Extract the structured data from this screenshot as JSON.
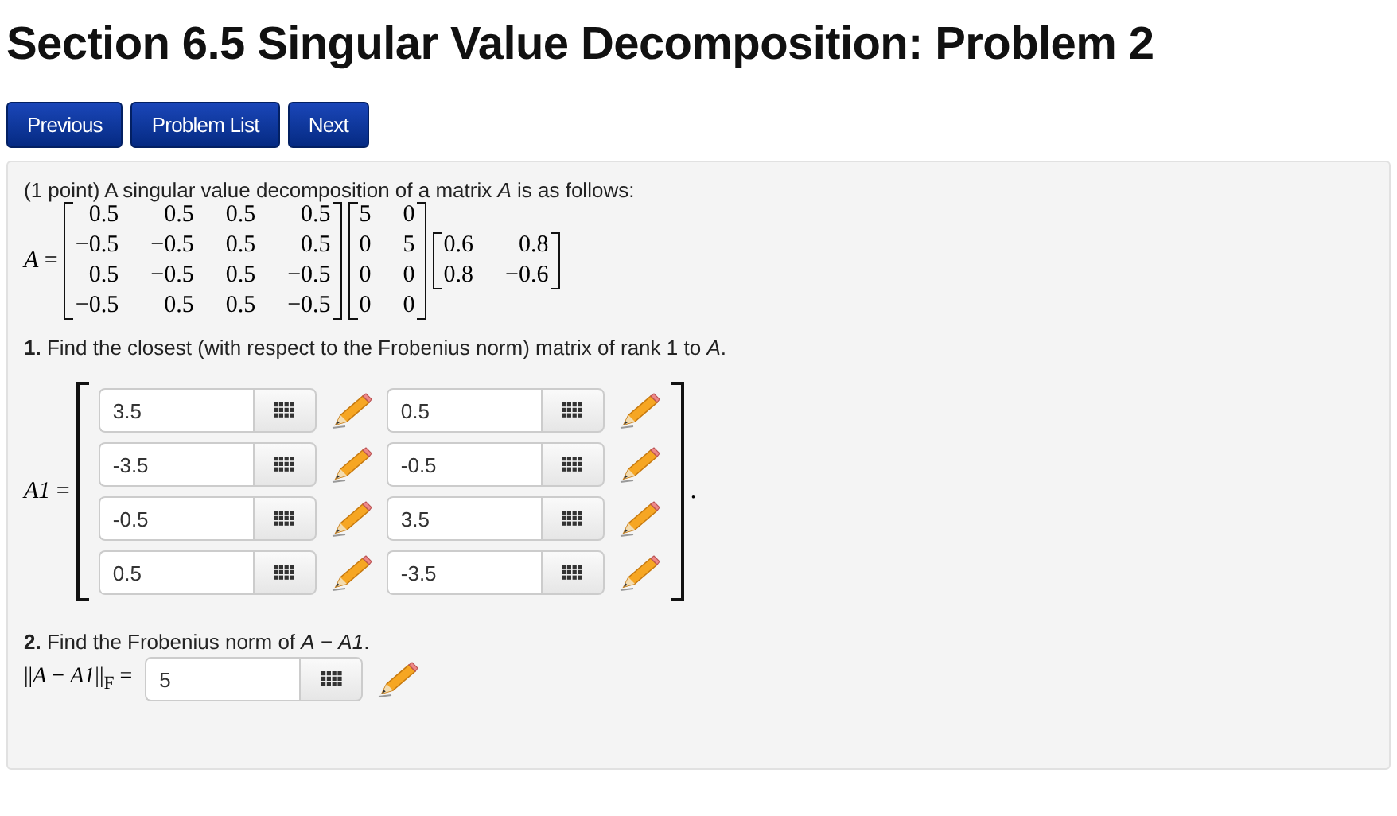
{
  "title": "Section 6.5 Singular Value Decomposition: Problem 2",
  "nav_buttons": [
    "Previous",
    "Problem List",
    "Next"
  ],
  "problem": {
    "intro": "(1 point) A singular value decomposition of a matrix *A* is as follows:",
    "svd_label": "*A* =",
    "matrices": [
      [
        [
          "0.5",
          "0.5",
          "0.5",
          "0.5"
        ],
        [
          "−0.5",
          "−0.5",
          "0.5",
          "0.5"
        ],
        [
          "0.5",
          "−0.5",
          "0.5",
          "−0.5"
        ],
        [
          "−0.5",
          "0.5",
          "0.5",
          "−0.5"
        ]
      ],
      [
        [
          "5",
          "0"
        ],
        [
          "0",
          "5"
        ],
        [
          "0",
          "0"
        ],
        [
          "0",
          "0"
        ]
      ],
      [
        [
          "0.6",
          "0.8"
        ],
        [
          "0.8",
          "−0.6"
        ]
      ]
    ],
    "part1": {
      "question": "**1.** Find the closest (with respect to the Frobenius norm) matrix of rank 1 to *A*.",
      "label": "*A1* =",
      "trailer": ".",
      "answers": [
        [
          "3.5",
          "0.5"
        ],
        [
          "-3.5",
          "-0.5"
        ],
        [
          "-0.5",
          "3.5"
        ],
        [
          "0.5",
          "-3.5"
        ]
      ]
    },
    "part2": {
      "question": "**2.** Find the Frobenius norm of *A* − *A1*.",
      "label": "||*A* − *A1*||$_{F}$ =",
      "answer": "5"
    }
  }
}
